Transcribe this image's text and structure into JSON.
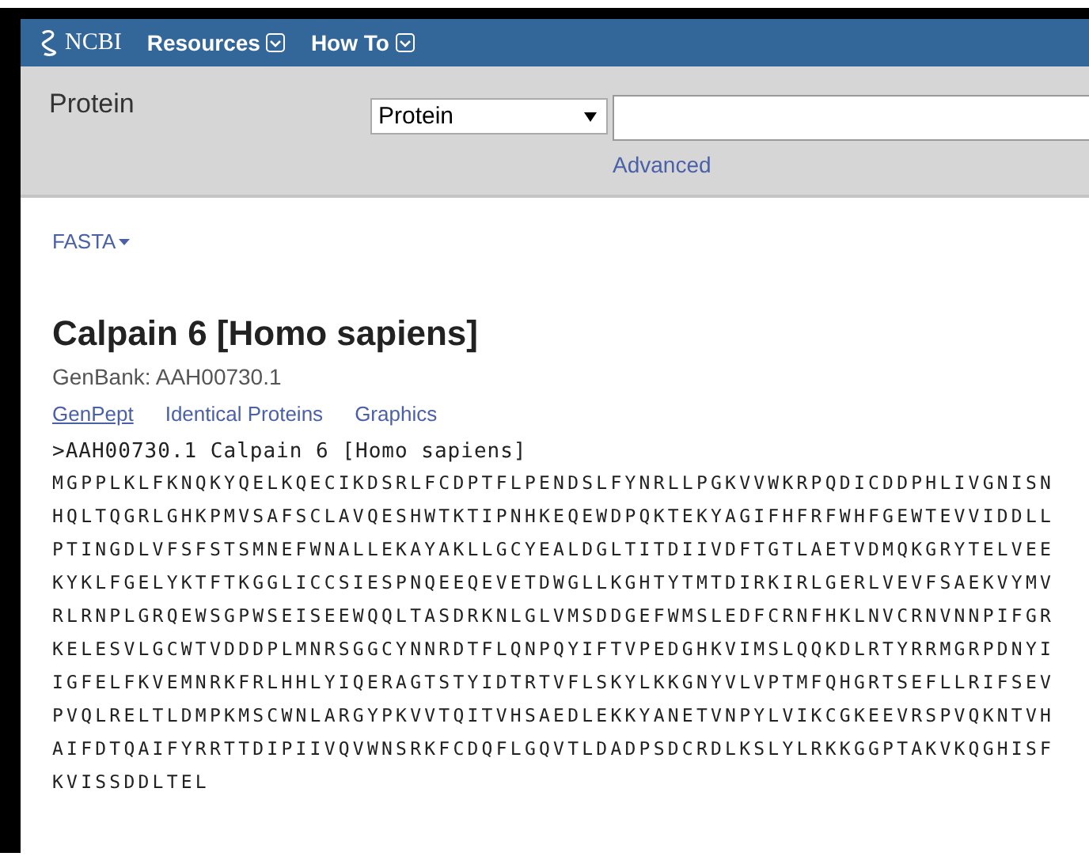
{
  "header": {
    "logo": "NCBI",
    "menus": [
      {
        "label": "Resources"
      },
      {
        "label": "How To"
      }
    ]
  },
  "search": {
    "database_label": "Protein",
    "select_value": "Protein",
    "advanced_link": "Advanced"
  },
  "format_menu": {
    "label": "FASTA"
  },
  "record": {
    "title": "Calpain 6 [Homo sapiens]",
    "accession": "GenBank: AAH00730.1",
    "links": [
      "GenPept",
      "Identical Proteins",
      "Graphics"
    ],
    "fasta_header": ">AAH00730.1 Calpain 6 [Homo sapiens]",
    "sequence_lines": [
      "MGPPLKLFKNQKYQELKQECIKDSRLFCDPTFLPENDSLFYNRLLPGKVVWKRPQDICDDPHLIVGNISN",
      "HQLTQGRLGHKPMVSAFSCLAVQESHWTKTIPNHKEQEWDPQKTEKYAGIFHFRFWHFGEWTEVVIDDLL",
      "PTINGDLVFSFSTSMNEFWNALLEKAYAKLLGCYEALDGLTITDIIVDFTGTLAETVDMQKGRYTELVEE",
      "KYKLFGELYKTFTKGGLICCSIESPNQEEQEVETDWGLLKGHTYTMTDIRKIRLGERLVEVFSAEKVYMV",
      "RLRNPLGRQEWSGPWSEISEEWQQLTASDRKNLGLVMSDDGEFWMSLEDFCRNFHKLNVCRNVNNPIFGR",
      "KELESVLGCWTVDDDPLMNRSGGCYNNRDTFLQNPQYIFTVPEDGHKVIMSLQQKDLRTYRRMGRPDNYI",
      "IGFELFKVEMNRKFRLHHLYIQERAGTSTYIDTRTVFLSKYLKKGNYVLVPTMFQHGRTSEFLLRIFSEV",
      "PVQLRELTLDMPKMSCWNLARGYPKVVTQITVHSAEDLEKKYANETVNPYLVIKCGKEEVRSPVQKNTVH",
      "AIFDTQAIFYRRTTDIPIIVQVWNSRKFCDQFLGQVTLDADPSDCRDLKSLYLRKKGGPTAKVKQGHISF",
      "KVISSDDLTEL"
    ]
  }
}
